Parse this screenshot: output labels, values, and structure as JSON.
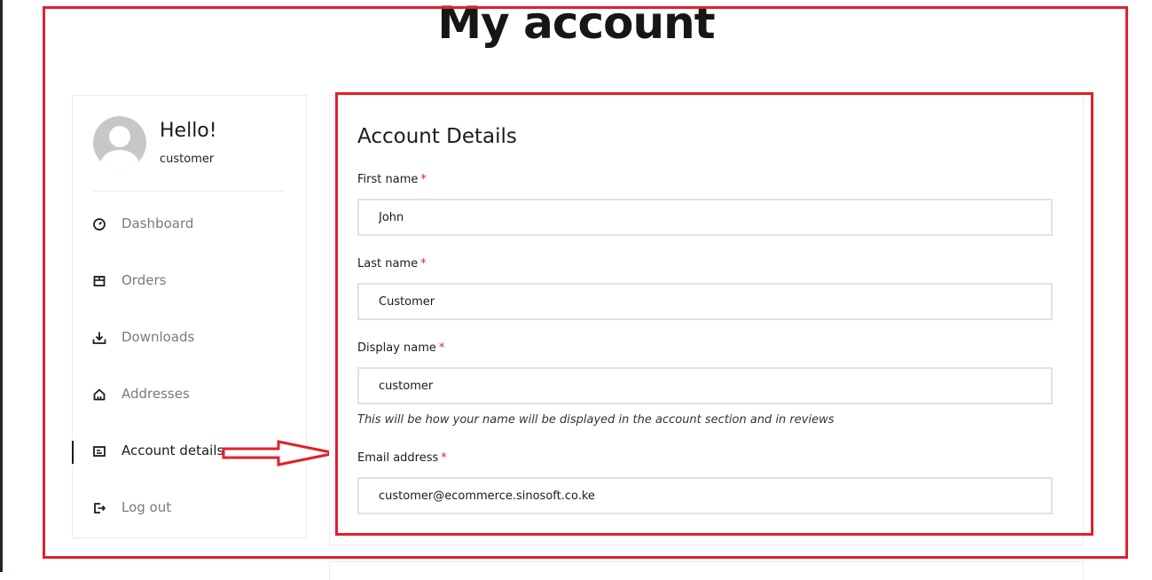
{
  "page": {
    "title": "My account"
  },
  "sidebar": {
    "greeting": "Hello!",
    "username": "customer",
    "items": [
      {
        "label": "Dashboard",
        "icon": "dashboard-gauge-icon",
        "active": false
      },
      {
        "label": "Orders",
        "icon": "box-icon",
        "active": false
      },
      {
        "label": "Downloads",
        "icon": "download-icon",
        "active": false
      },
      {
        "label": "Addresses",
        "icon": "home-icon",
        "active": false
      },
      {
        "label": "Account details",
        "icon": "id-card-icon",
        "active": true
      },
      {
        "label": "Log out",
        "icon": "logout-icon",
        "active": false
      }
    ]
  },
  "account_details": {
    "title": "Account Details",
    "required_marker": "*",
    "fields": {
      "first_name": {
        "label": "First name",
        "value": "John"
      },
      "last_name": {
        "label": "Last name",
        "value": "Customer"
      },
      "display_name": {
        "label": "Display name",
        "value": "customer",
        "hint": "This will be how your name will be displayed in the account section and in reviews"
      },
      "email": {
        "label": "Email address",
        "value": "customer@ecommerce.sinosoft.co.ke"
      }
    }
  },
  "colors": {
    "annotation_red": "#e0202c",
    "text": "#1b1b1b",
    "muted": "#7a7a7a",
    "border": "#e2e2e2"
  }
}
